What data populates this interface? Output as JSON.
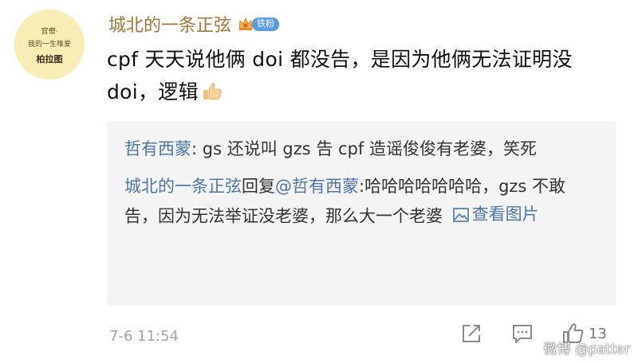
{
  "avatar": {
    "line1": "官僚·",
    "line2": "我的一生唯爱",
    "line3": "柏拉图"
  },
  "post": {
    "username": "城北的一条正弦",
    "badge_label": "铁粉",
    "text": "cpf 天天说他俩 doi 都没告，是因为他俩无法证明没 doi，逻辑",
    "time": "7-6 11:54",
    "like_count": "13"
  },
  "replies": [
    {
      "author": "哲有西蒙",
      "separator": ": ",
      "content": "gs 还说叫 gzs 告 cpf 造谣俊俊有老婆，笑死"
    },
    {
      "author": "城北的一条正弦",
      "reply_word": "回复",
      "mention": "@哲有西蒙",
      "content": ":哈哈哈哈哈哈哈，gzs 不敢告，因为无法举证没老婆，那么大一个老婆",
      "view_picture": "查看图片"
    }
  ],
  "watermark": "微博 @patter",
  "icons": {
    "badge": "crown-badge-icon",
    "thumb": "thumbs-up-emoji-icon",
    "share": "share-icon",
    "comment": "comment-icon",
    "like": "like-icon",
    "picture": "picture-icon"
  },
  "colors": {
    "username": "#a0793b",
    "link": "#4e76a8",
    "badge": "#5b9be0",
    "quote_bg": "#f4f4f4"
  }
}
